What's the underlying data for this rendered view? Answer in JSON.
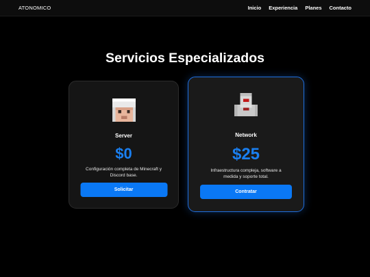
{
  "nav": {
    "brand": "ATONOMICO",
    "links": [
      "Inicio",
      "Experiencia",
      "Planes",
      "Contacto"
    ]
  },
  "main": {
    "title": "Servicios Especializados"
  },
  "plans": [
    {
      "name": "Server",
      "price": "$0",
      "description": "Configuración completa de Minecraft y Discord base.",
      "button": "Solicitar",
      "avatar_icon": "minecraft-white-hood-head-icon"
    },
    {
      "name": "Network",
      "price": "$25",
      "description": "Infraestructura compleja, software a medida y soporte total.",
      "button": "Contratar",
      "avatar_icon": "minecraft-red-eyed-skin-icon"
    }
  ],
  "colors": {
    "accent": "#0a78f5",
    "price": "#1a7ff0",
    "highlight_border": "#1f6fe0",
    "background": "#000000",
    "card": "#151515"
  }
}
